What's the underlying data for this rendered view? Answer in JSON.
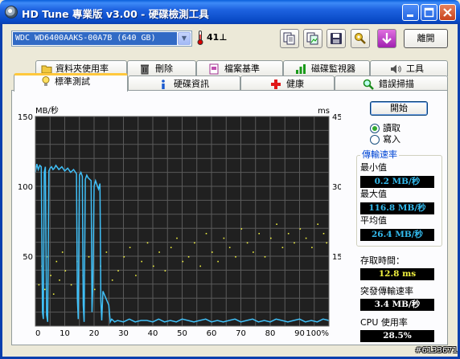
{
  "window": {
    "title": "HD Tune 專業版 v3.00 - 硬碟檢測工具"
  },
  "toolbar": {
    "drive": "WDC WD6400AAKS-00A7B (640 GB)",
    "temperature": "41",
    "temperature_unit": "⊥",
    "exit_label": "離開"
  },
  "tabs_top": [
    "資料夾使用率",
    "刪除",
    "檔案基準",
    "磁碟監視器",
    "工具"
  ],
  "tabs_bottom": [
    "標準測試",
    "硬碟資訊",
    "健康",
    "錯誤掃描"
  ],
  "active_tab": "標準測試",
  "controls": {
    "start_label": "開始",
    "read_label": "讀取",
    "write_label": "寫入",
    "mode": "read"
  },
  "stats": {
    "transfer_rate_title": "傳輸速率",
    "min_label": "最小值",
    "min_value": "0.2 MB/秒",
    "max_label": "最大值",
    "max_value": "116.8 MB/秒",
    "avg_label": "平均值",
    "avg_value": "26.4 MB/秒",
    "access_label": "存取時間：",
    "access_value": "12.8 ms",
    "burst_label": "突發傳輸速率",
    "burst_value": "3.4 MB/秒",
    "cpu_label": "CPU 使用率",
    "cpu_value": "28.5%"
  },
  "colors": {
    "transfer": "#40c0f8",
    "access": "#f0f040",
    "plot_bg": "#202020",
    "accent": "#0046d5"
  },
  "chart_data": {
    "type": "line",
    "ylabel_left": "MB/秒",
    "ylabel_right": "ms",
    "ylim_left": [
      0,
      150
    ],
    "ylim_right": [
      0,
      45
    ],
    "yticks_left": [
      "150",
      "100",
      "50"
    ],
    "yticks_right": [
      "45",
      "30",
      "15"
    ],
    "x_ticks": [
      "0",
      "10",
      "20",
      "30",
      "40",
      "50",
      "60",
      "70",
      "80",
      "90",
      "100%"
    ],
    "grid": true,
    "series": [
      {
        "x": [
          0,
          0.5,
          1,
          1.5,
          2,
          2.4,
          2.7,
          3,
          3.4,
          3.8,
          4.2,
          4.6,
          5,
          5.5,
          6,
          6.5,
          7,
          8,
          9,
          10,
          11,
          12,
          13,
          14,
          14.3,
          14.6,
          15,
          15.5,
          16,
          16.3,
          16.6,
          17,
          17.5,
          18,
          19,
          19.3,
          19.6,
          20,
          20.5,
          21,
          21.5,
          22,
          22.3,
          22.6,
          23,
          24,
          25,
          25.5,
          26,
          26.5,
          27,
          28,
          30,
          32,
          34,
          36,
          38,
          40,
          42,
          44,
          46,
          48,
          50,
          52,
          54,
          56,
          58,
          60,
          62,
          64,
          66,
          68,
          70,
          72,
          74,
          76,
          78,
          80,
          82,
          84,
          86,
          88,
          90,
          92,
          94,
          96,
          98,
          100
        ],
        "values": [
          110,
          116,
          112,
          115,
          114,
          10,
          5,
          110,
          114,
          8,
          3,
          111,
          113,
          114,
          112,
          113,
          115,
          112,
          114,
          111,
          113,
          110,
          112,
          109,
          20,
          5,
          108,
          110,
          107,
          15,
          3,
          105,
          108,
          106,
          104,
          10,
          30,
          100,
          104,
          101,
          98,
          102,
          18,
          4,
          25,
          20,
          15,
          3,
          5,
          4,
          3,
          4,
          3,
          5,
          3,
          4,
          4,
          3,
          5,
          3,
          4,
          3,
          5,
          4,
          3,
          4,
          5,
          3,
          4,
          3,
          4,
          5,
          3,
          4,
          5,
          3,
          4,
          3,
          5,
          4,
          3,
          4,
          5,
          3,
          4,
          3,
          5,
          4
        ]
      },
      {
        "x": [
          1,
          2,
          3,
          4,
          5,
          6,
          7,
          8,
          9,
          10,
          12,
          14,
          16,
          18,
          20,
          22,
          24,
          26,
          28,
          30,
          32,
          34,
          36,
          38,
          40,
          42,
          44,
          46,
          48,
          50,
          52,
          54,
          56,
          58,
          60,
          62,
          64,
          66,
          68,
          70,
          72,
          74,
          76,
          78,
          80,
          82,
          84,
          86,
          88,
          90,
          92,
          94,
          96,
          98,
          99
        ],
        "values": [
          9,
          13,
          8,
          15,
          11,
          7,
          14,
          10,
          16,
          12,
          9,
          14,
          11,
          15,
          8,
          13,
          16,
          10,
          12,
          15,
          17,
          11,
          14,
          18,
          13,
          16,
          12,
          17,
          19,
          14,
          15,
          18,
          13,
          20,
          16,
          14,
          19,
          17,
          15,
          21,
          18,
          16,
          20,
          15,
          19,
          22,
          17,
          20,
          18,
          21,
          19,
          17,
          22,
          20,
          18
        ]
      }
    ]
  }
}
